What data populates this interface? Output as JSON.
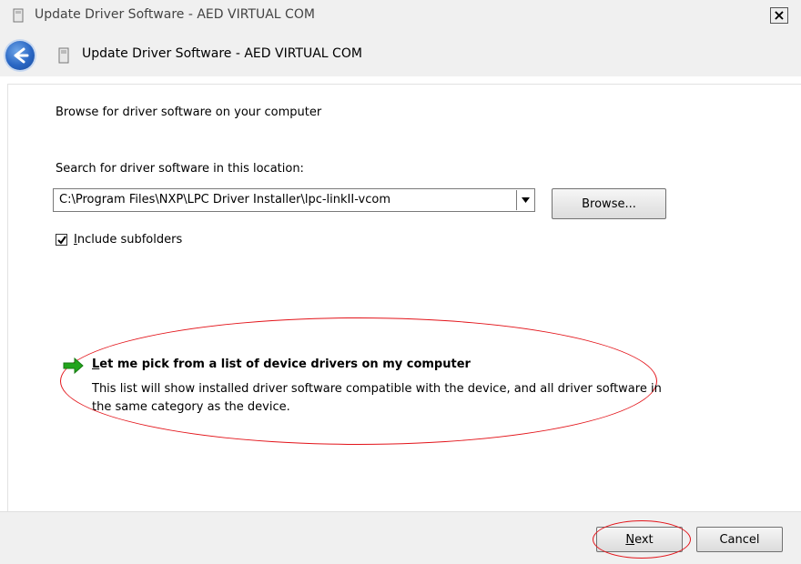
{
  "window": {
    "title": "Update Driver Software - AED VIRTUAL COM",
    "close_glyph": "×"
  },
  "navbar": {
    "title": "Update Driver Software - AED VIRTUAL COM"
  },
  "content": {
    "heading": "Browse for driver software on your computer",
    "search_label": "Search for driver software in this location:",
    "path_value": "C:\\Program Files\\NXP\\LPC Driver Installer\\lpc-linkII-vcom",
    "browse_label": "Browse...",
    "include_subfolders_label": "Include subfolders",
    "include_subfolders_checked": true,
    "pick_link": "Let me pick from a list of device drivers on my computer",
    "pick_desc": "This list will show installed driver software compatible with the device, and all driver software in the same category as the device."
  },
  "footer": {
    "next_label": "Next",
    "cancel_label": "Cancel"
  },
  "colors": {
    "annotation": "#e3141a",
    "back_button": "#2a67c4",
    "arrow_green": "#22a51c"
  },
  "icons": [
    "device-icon",
    "back-arrow-icon",
    "close-icon",
    "dropdown-arrow-icon",
    "checkmark-icon",
    "green-arrow-icon"
  ]
}
